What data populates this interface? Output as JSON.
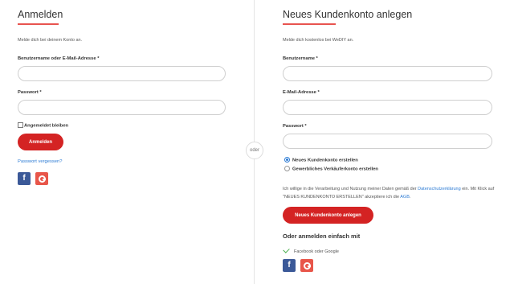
{
  "login": {
    "title": "Anmelden",
    "subtitle": "Melde dich bei deinem Konto an.",
    "username_label": "Benutzername oder E-Mail-Adresse *",
    "password_label": "Passwort *",
    "remember_label": "Angemeldet bleiben",
    "submit_label": "Anmelden",
    "forgot_label": "Passwort vergessen?"
  },
  "divider": {
    "text": "oder"
  },
  "register": {
    "title": "Neues Kundenkonto anlegen",
    "subtitle": "Melde dich kostenlos bei WeDIY an.",
    "username_label": "Benutzername *",
    "email_label": "E-Mail-Adresse *",
    "password_label": "Passwort *",
    "account_types": [
      "Neues Kundenkonto erstellen",
      "Gewerbliches Verkäuferkonto erstellen"
    ],
    "selected_account_type": "Neues Kundenkonto erstellen",
    "consent_text_1": "Ich willige in die Verarbeitung und Nutzung meiner Daten gemäß der ",
    "consent_link_privacy": "Datenschutzerklärung",
    "consent_text_2": " ein. Mit Klick auf \"NEUES KUNDENKONTO ERSTELLEN\" akzeptiere ich die ",
    "consent_link_terms": "AGB",
    "consent_text_3": ".",
    "submit_label": "Neues Kundenkonto anlegen",
    "social_title": "Oder anmelden einfach mit",
    "social_note": "Facebook oder Google"
  },
  "social": {
    "facebook_glyph": "f"
  },
  "colors": {
    "accent": "#d42323",
    "link": "#2c7bd4",
    "facebook": "#3b5998",
    "google": "#e8564a",
    "check": "#4caf50"
  }
}
